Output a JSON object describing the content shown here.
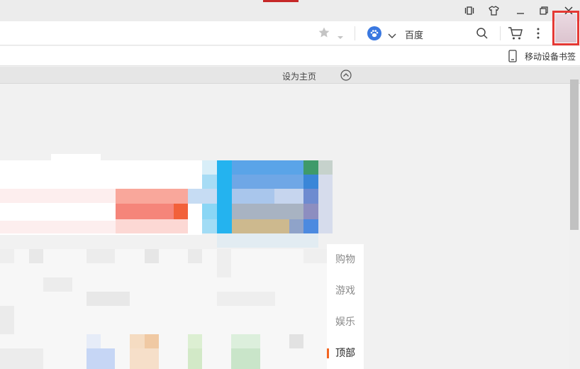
{
  "toolbar": {
    "search_engine": "百度"
  },
  "bookmarks": {
    "mobile_label": "移动设备书签"
  },
  "homepage": {
    "set_home_label": "设为主页"
  },
  "side_nav": {
    "items": [
      "购物",
      "游戏",
      "娱乐",
      "顶部"
    ]
  },
  "colors": {
    "accent": "#f26522",
    "highlight": "#e53935",
    "engine": "#3a78e0"
  }
}
